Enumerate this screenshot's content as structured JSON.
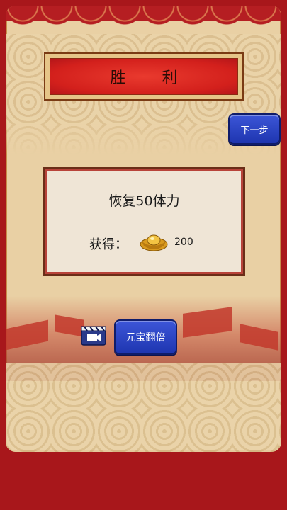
{
  "title": "胜  利",
  "next_button": "下一步",
  "reward": {
    "description": "恢复50体力",
    "obtain_label": "获得：",
    "amount": "200",
    "currency_icon": "gold-ingot-icon"
  },
  "double_button": "元宝翻倍",
  "video_icon": "video-ad-icon",
  "colors": {
    "background_red": "#a8171b",
    "panel_cream": "#efe5d6",
    "button_blue": "#2c45c8",
    "banner_red": "#d3201c"
  }
}
